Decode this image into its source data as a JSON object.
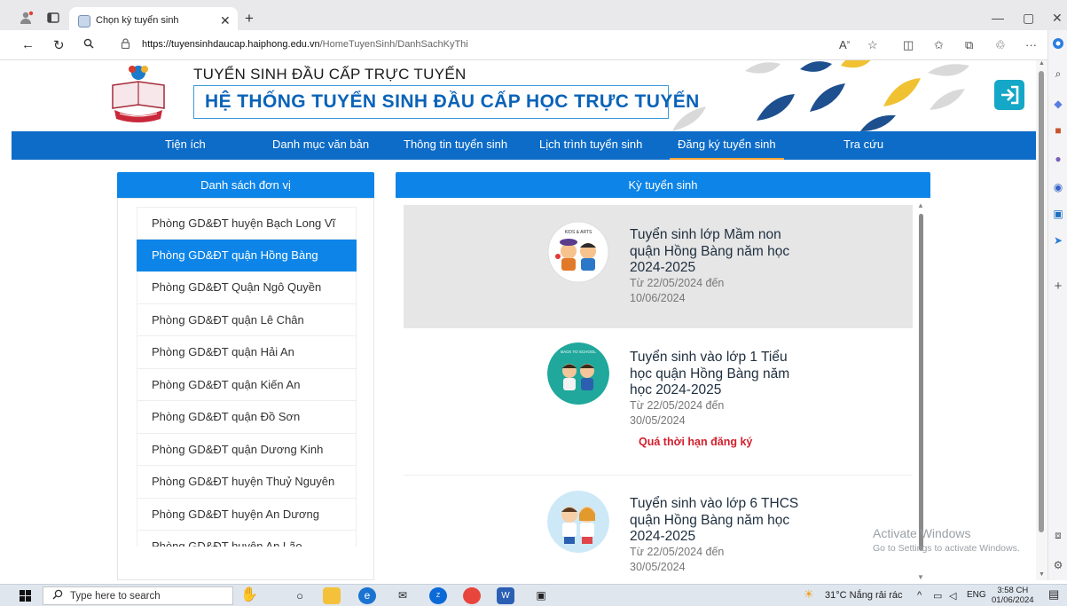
{
  "browser": {
    "tab_title": "Chọn kỳ tuyển sinh",
    "url_host": "https://tuyensinhdaucap.haiphong.edu.vn",
    "url_path": "/HomeTuyenSinh/DanhSachKyThi",
    "read_aloud": "A"
  },
  "site": {
    "title_small": "TUYỂN SINH ĐẦU CẤP TRỰC TUYẾN",
    "title_big": "HỆ THỐNG TUYỂN SINH ĐẦU CẤP HỌC TRỰC TUYẾN",
    "colors": {
      "nav": "#0d6cc7",
      "panel_head": "#0d84e7",
      "accent": "#f1a33a",
      "status": "#d0202e"
    }
  },
  "nav": [
    {
      "label": "Tiện ích"
    },
    {
      "label": "Danh mục văn bản"
    },
    {
      "label": "Thông tin tuyển sinh"
    },
    {
      "label": "Lịch trình tuyển sinh"
    },
    {
      "label": "Đăng ký tuyển sinh",
      "active": true
    },
    {
      "label": "Tra cứu"
    }
  ],
  "left_panel": {
    "heading": "Danh sách đơn vị",
    "units": [
      "Phòng GD&ĐT huyện Bạch Long Vĩ",
      "Phòng GD&ĐT quận Hồng Bàng",
      "Phòng GD&ĐT Quận Ngô Quyền",
      "Phòng GD&ĐT quận Lê Chân",
      "Phòng GD&ĐT quận Hải An",
      "Phòng GD&ĐT quận Kiến An",
      "Phòng GD&ĐT quận Đồ Sơn",
      "Phòng GD&ĐT quận Dương Kinh",
      "Phòng GD&ĐT huyện Thuỷ Nguyên",
      "Phòng GD&ĐT huyện An Dương",
      "Phòng GD&ĐT huyện An Lão"
    ],
    "selected_index": 1
  },
  "right_panel": {
    "heading": "Kỳ tuyển sinh",
    "terms": [
      {
        "title": "Tuyển sinh lớp Mầm non quận Hồng Bàng năm học 2024-2025",
        "date": "Từ 22/05/2024 đến 10/06/2024",
        "status": "",
        "image_label": "KIDS & ARTS"
      },
      {
        "title": "Tuyển sinh vào lớp 1 Tiểu học quận Hồng Bàng năm học 2024-2025",
        "date": "Từ 22/05/2024 đến 30/05/2024",
        "status": "Quá thời hạn đăng ký",
        "image_label": "BACK TO SCHOOL"
      },
      {
        "title": "Tuyển sinh vào lớp 6 THCS quận Hồng Bàng năm học 2024-2025",
        "date": "Từ 22/05/2024 đến 30/05/2024",
        "status": "",
        "image_label": ""
      }
    ]
  },
  "watermark": {
    "line1": "Activate Windows",
    "line2": "Go to Settings to activate Windows."
  },
  "taskbar": {
    "search_placeholder": "Type here to search",
    "weather": "31°C  Nắng rải rác",
    "lang": "ENG",
    "time": "3:58 CH",
    "date": "01/06/2024"
  }
}
